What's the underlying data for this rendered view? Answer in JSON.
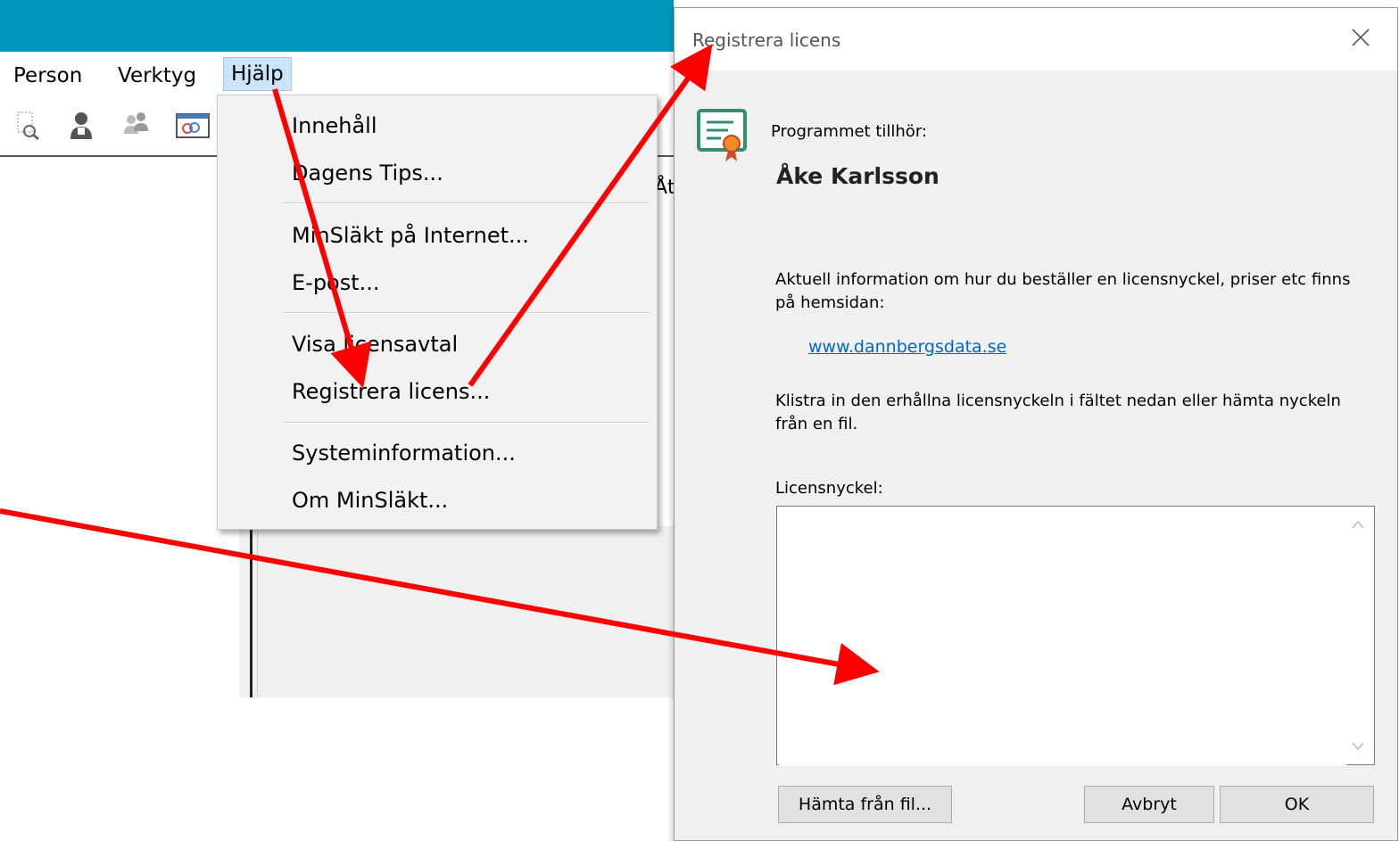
{
  "menubar": {
    "items": [
      {
        "label": "Person"
      },
      {
        "label": "Verktyg"
      },
      {
        "label": "Hjälp"
      }
    ]
  },
  "partial_label": "Åt",
  "help_menu": {
    "items": [
      {
        "label": "Innehåll"
      },
      {
        "label": "Dagens Tips..."
      },
      {
        "label": "MinSläkt på Internet..."
      },
      {
        "label": "E-post..."
      },
      {
        "label": "Visa licensavtal"
      },
      {
        "label": "Registrera licens..."
      },
      {
        "label": "Systeminformation..."
      },
      {
        "label": "Om MinSläkt..."
      }
    ]
  },
  "dialog": {
    "title": "Registrera licens",
    "owner_label": "Programmet tillhör:",
    "owner_name": "Åke Karlsson",
    "info_text": "Aktuell information om hur du beställer en licensnyckel, priser etc finns på hemsidan:",
    "website": "www.dannbergsdata.se",
    "paste_text": "Klistra in den erhållna licensnyckeln i fältet nedan eller hämta nyckeln från en fil.",
    "key_label": "Licensnyckel:",
    "key_value": "",
    "buttons": {
      "fetch": "Hämta från fil...",
      "cancel": "Avbryt",
      "ok": "OK"
    }
  },
  "colors": {
    "titlebar": "#0099bc",
    "arrow": "#ff0000",
    "link": "#0066cc"
  }
}
